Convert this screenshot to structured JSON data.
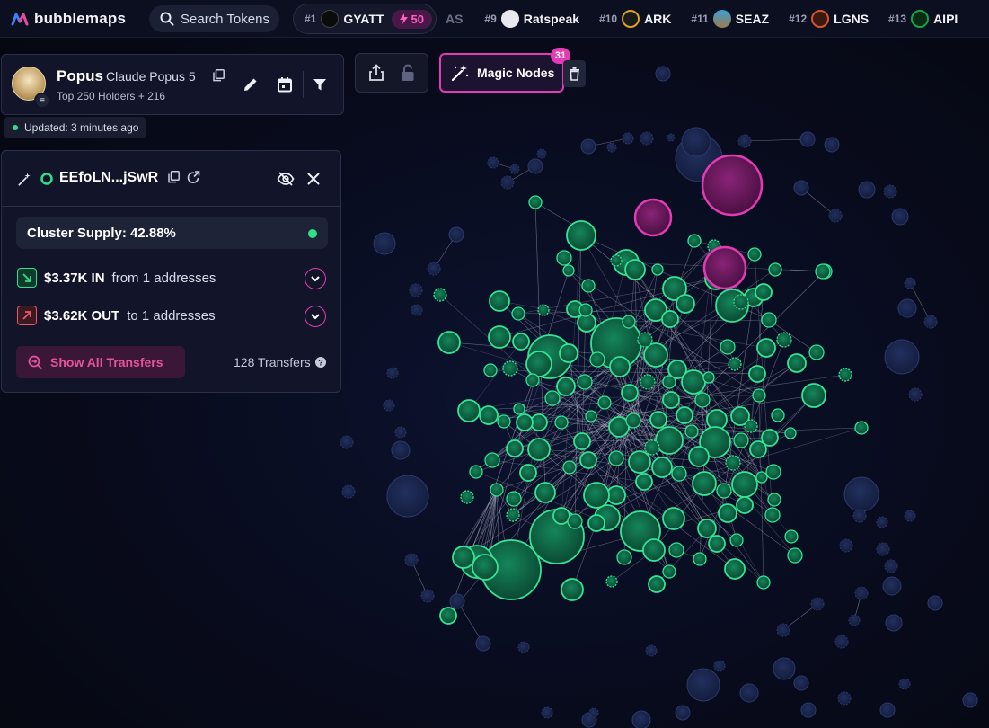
{
  "brand": {
    "name": "bubblemaps"
  },
  "search": {
    "placeholder": "Search Tokens"
  },
  "ticker": [
    {
      "rank": "#1",
      "name": "GYATT",
      "boost": "50",
      "logo_color": "#0b0b0b"
    },
    {
      "rank": "",
      "name": "AS",
      "faded": true
    },
    {
      "rank": "#9",
      "name": "Ratspeak",
      "logo_color": "#e8e8ee"
    },
    {
      "rank": "#10",
      "name": "ARK",
      "logo_color": "#d9a22a"
    },
    {
      "rank": "#11",
      "name": "SEAZ",
      "logo_color": "#3aa0d8"
    },
    {
      "rank": "#12",
      "name": "LGNS",
      "logo_color": "#d4552d"
    },
    {
      "rank": "#13",
      "name": "AIPI",
      "logo_color": "#16a34a"
    }
  ],
  "token": {
    "symbol": "Popus",
    "name": "Claude Popus 5",
    "subtitle": "Top 250 Holders + 216",
    "updated": "Updated: 3 minutes ago"
  },
  "magic_nodes": {
    "label": "Magic Nodes",
    "count": "31"
  },
  "cluster": {
    "address": "EEfoLN...jSwR",
    "supply": "Cluster Supply: 42.88%",
    "in_amount": "$3.37K IN",
    "in_desc": "from 1 addresses",
    "out_amount": "$3.62K OUT",
    "out_desc": "to 1 addresses",
    "show_transfers": "Show All Transfers",
    "transfers_count": "128 Transfers"
  },
  "colors": {
    "accent": "#e23bb3",
    "cluster_green": "#2ee08a",
    "cluster_fill": "#0f6a45",
    "bubble_blue": "#1c2a55",
    "magic_fill": "#6a1a5c"
  }
}
